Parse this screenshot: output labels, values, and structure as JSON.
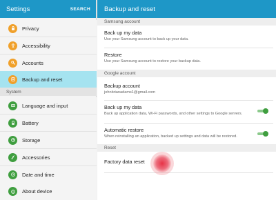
{
  "left": {
    "title": "Settings",
    "search_label": "SEARCH",
    "items_top": [
      {
        "label": "Privacy",
        "icon": "privacy-icon"
      },
      {
        "label": "Accessibility",
        "icon": "accessibility-icon"
      },
      {
        "label": "Accounts",
        "icon": "accounts-icon"
      },
      {
        "label": "Backup and reset",
        "icon": "backup-reset-icon",
        "selected": true
      }
    ],
    "section_system": "System",
    "items_system": [
      {
        "label": "Language and input",
        "icon": "language-icon"
      },
      {
        "label": "Battery",
        "icon": "battery-icon"
      },
      {
        "label": "Storage",
        "icon": "storage-icon"
      },
      {
        "label": "Accessories",
        "icon": "accessories-icon"
      },
      {
        "label": "Date and time",
        "icon": "clock-icon"
      },
      {
        "label": "About device",
        "icon": "info-icon"
      }
    ]
  },
  "right": {
    "title": "Backup and reset",
    "samsung_section": "Samsung account",
    "samsung_backup": {
      "title": "Back up my data",
      "subtitle": "Use your Samsung account to back up your data."
    },
    "samsung_restore": {
      "title": "Restore",
      "subtitle": "Use your Samsung account to restore your backup data."
    },
    "google_section": "Google account",
    "backup_account": {
      "title": "Backup account",
      "subtitle": "johnbrianadams1@gmail.com"
    },
    "google_backup": {
      "title": "Back up my data",
      "subtitle": "Back up application data, Wi-Fi passwords, and other settings to Google servers.",
      "enabled": true
    },
    "auto_restore": {
      "title": "Automatic restore",
      "subtitle": "When reinstalling an application, backed up settings and data will be restored.",
      "enabled": true
    },
    "reset_section": "Reset",
    "factory_reset": {
      "title": "Factory data reset"
    }
  },
  "colors": {
    "accent": "#1e97c7",
    "selected": "#a5e3f0",
    "orange_icon": "#f0a02a",
    "green_icon": "#3f9e3f",
    "toggle_on": "#3f9e3f",
    "touch": "#e6283c"
  }
}
